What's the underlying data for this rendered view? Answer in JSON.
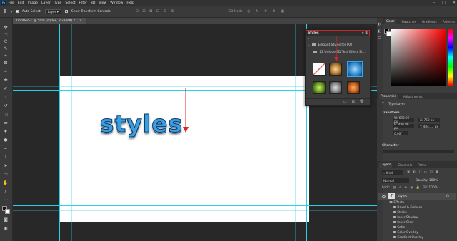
{
  "menu": [
    "File",
    "Edit",
    "Image",
    "Layer",
    "Type",
    "Select",
    "Filter",
    "3D",
    "View",
    "Window",
    "Help"
  ],
  "app_logo": "Ps",
  "options_bar": {
    "auto_select_label": "Auto-Select:",
    "auto_select_value": "Layer",
    "show_transform_label": "Show Transform Controls",
    "mode_label": "3D Mode:"
  },
  "document_tab": {
    "title": "Untitled-1 @ 50% (styles, RGB/8#) *",
    "close": "×"
  },
  "styles_panel": {
    "title": "Styles",
    "items": [
      {
        "label": "Elegant Styles for IKU"
      },
      {
        "label": "12 Unique 3D Text Effect St..."
      }
    ]
  },
  "canvas_text": "styles",
  "right_panels": {
    "color_tabs": [
      "Color",
      "Swatches",
      "Gradients",
      "Patterns"
    ],
    "properties_tabs": [
      "Properties",
      "Adjustments"
    ],
    "type_layer": "Type Layer",
    "transform_label": "Transform",
    "w": "W: 688.06 px",
    "h": "H: 486.86 px",
    "x": "X: 750 px",
    "y": "Y: 484.17 px",
    "angle": "0.00°",
    "character_label": "Character",
    "layers_tabs": [
      "Layers",
      "Channels",
      "Paths"
    ],
    "kind_label": "Kind",
    "blend_mode": "Normal",
    "opacity": "Opacity: 100%",
    "lock_label": "Lock:",
    "fill": "Fill: 100%",
    "layer_name": "styles",
    "effects_label": "Effects",
    "effects": [
      "Bevel & Emboss",
      "Stroke",
      "Inner Shadow",
      "Inner Glow",
      "Satin",
      "Color Overlay",
      "Gradient Overlay"
    ]
  },
  "colors": {
    "guide": "#27d1e6",
    "accent": "#31a8ff",
    "arrow": "#e2202a",
    "highlight": "#d1232a"
  }
}
